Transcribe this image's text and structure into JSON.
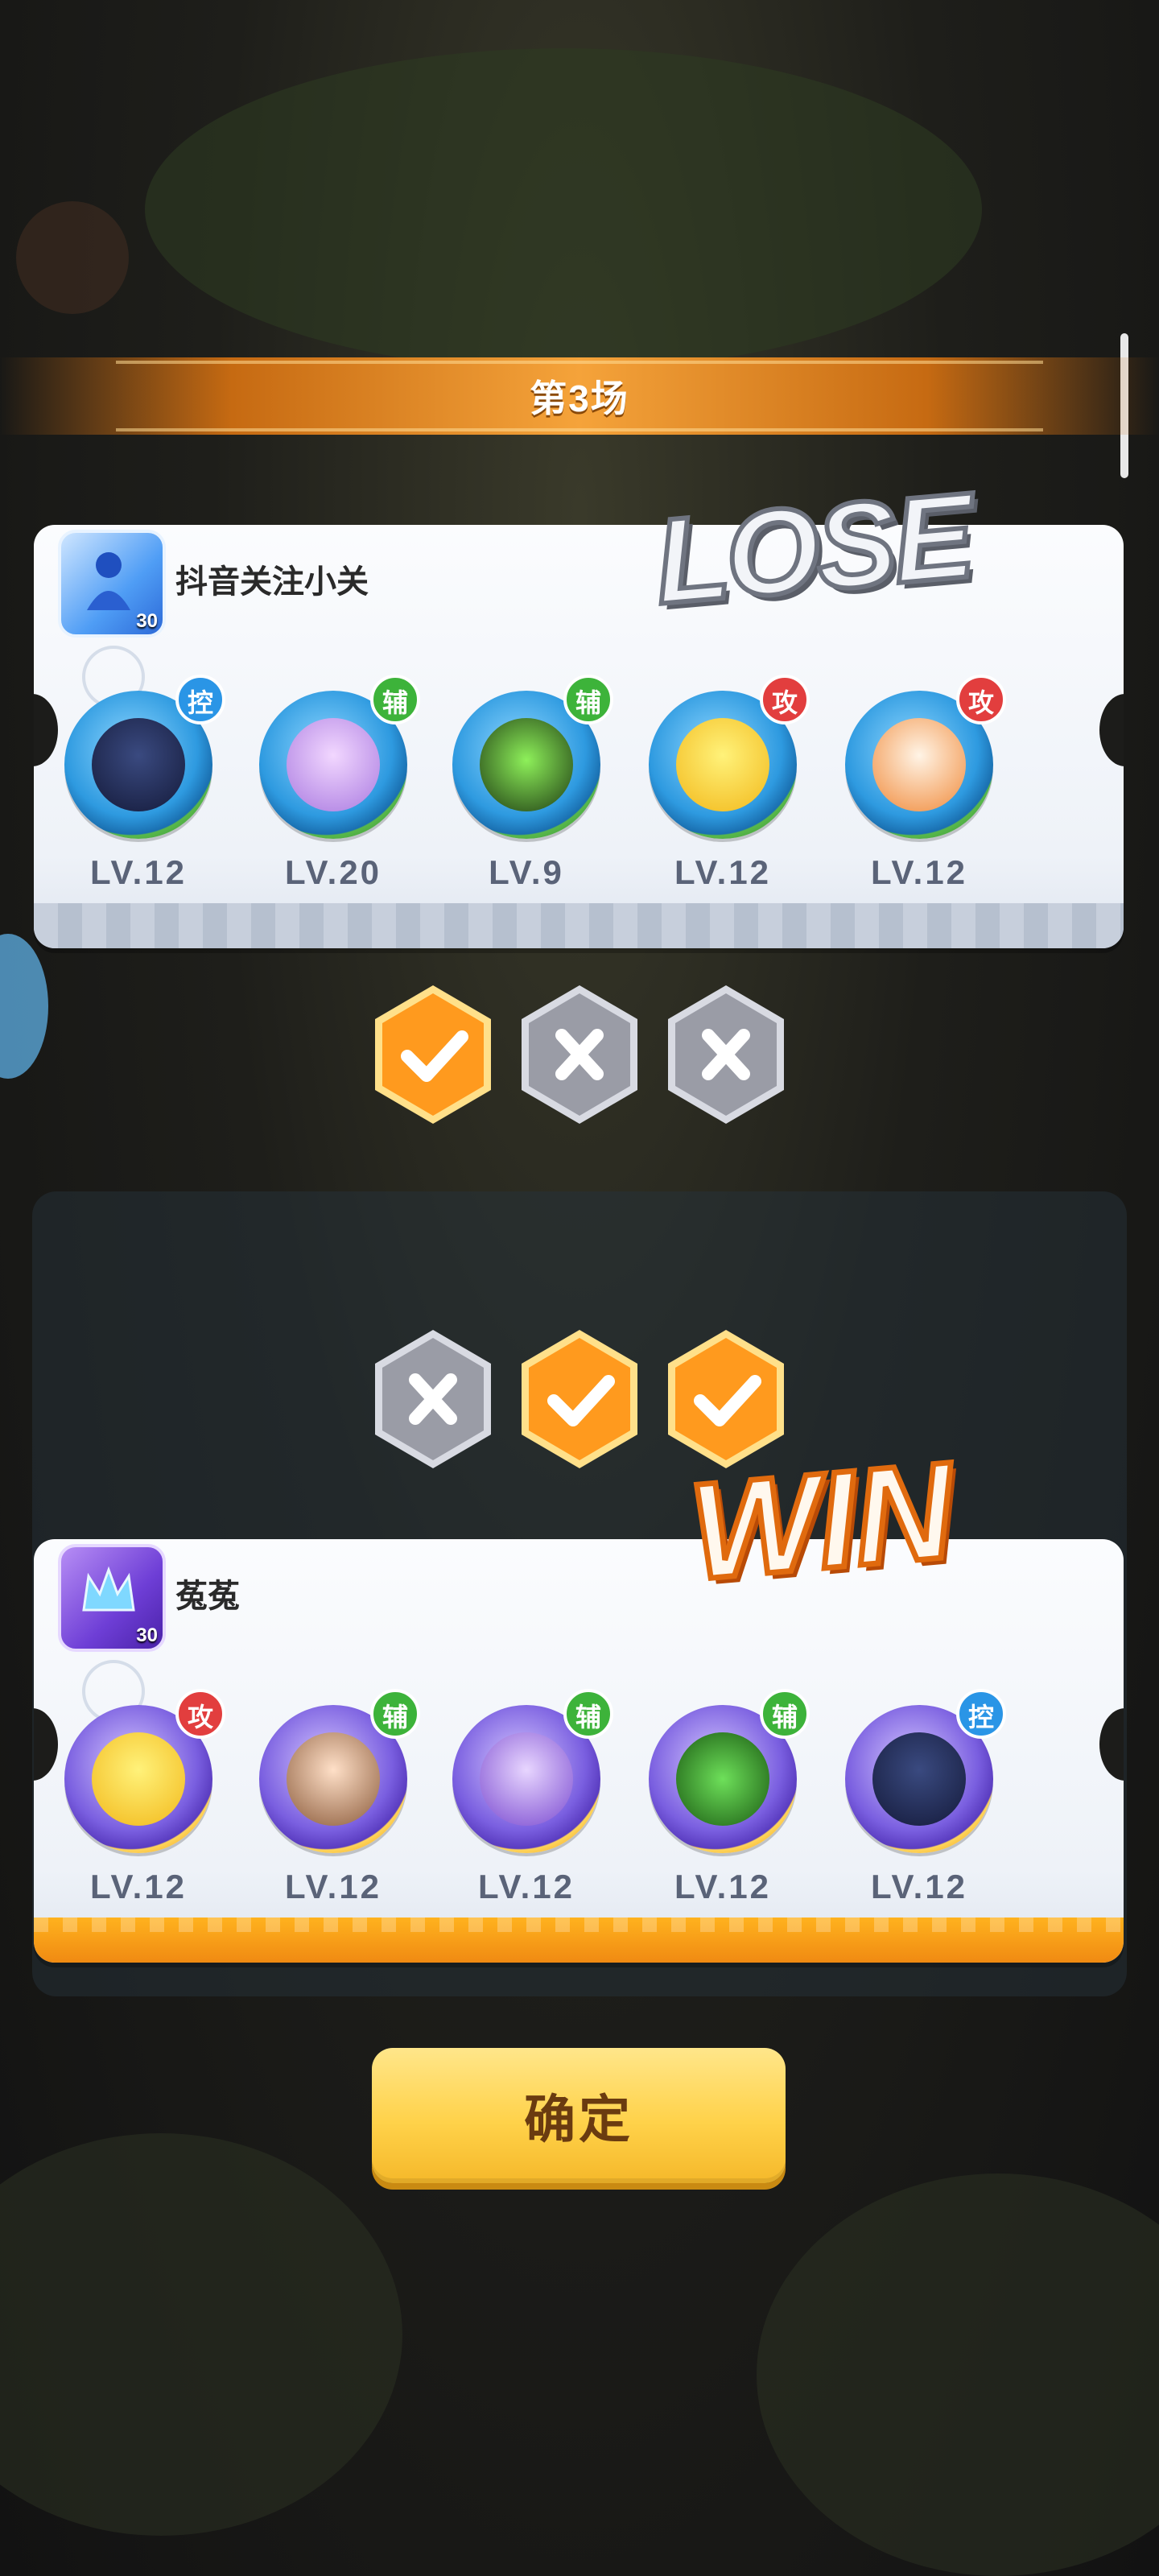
{
  "round": {
    "title": "第3场"
  },
  "top_team": {
    "player_name": "抖音关注小关",
    "player_level": "30",
    "result": "LOSE",
    "heroes": [
      {
        "role": "控",
        "role_type": "kong",
        "level": "LV.12",
        "icon": "dark-blob-hero-icon"
      },
      {
        "role": "辅",
        "role_type": "fu",
        "level": "LV.20",
        "icon": "lotus-hero-icon"
      },
      {
        "role": "辅",
        "role_type": "fu",
        "level": "LV.9",
        "icon": "green-shadow-hero-icon"
      },
      {
        "role": "攻",
        "role_type": "gong",
        "level": "LV.12",
        "icon": "yellow-blob-hero-icon"
      },
      {
        "role": "攻",
        "role_type": "gong",
        "level": "LV.12",
        "icon": "fox-hero-icon"
      }
    ]
  },
  "top_results": [
    "win",
    "lose",
    "lose"
  ],
  "bottom_results": [
    "lose",
    "win",
    "win"
  ],
  "bottom_team": {
    "player_name": "菟菟",
    "player_level": "30",
    "result": "WIN",
    "heroes": [
      {
        "role": "攻",
        "role_type": "gong",
        "level": "LV.12",
        "icon": "yellow-blob-hero-icon"
      },
      {
        "role": "辅",
        "role_type": "fu",
        "level": "LV.12",
        "icon": "girl-hero-icon"
      },
      {
        "role": "辅",
        "role_type": "fu",
        "level": "LV.12",
        "icon": "hammer-hero-icon"
      },
      {
        "role": "辅",
        "role_type": "fu",
        "level": "LV.12",
        "icon": "green-frog-hero-icon"
      },
      {
        "role": "控",
        "role_type": "kong",
        "level": "LV.12",
        "icon": "dark-blob-hero-icon"
      }
    ]
  },
  "confirm": {
    "label": "确定"
  },
  "colors": {
    "win_hex": "#ff9a1e",
    "lose_hex": "#9a9ca6",
    "role_kong": "#2a95e6",
    "role_fu": "#3db33a",
    "role_gong": "#e23e3e"
  }
}
